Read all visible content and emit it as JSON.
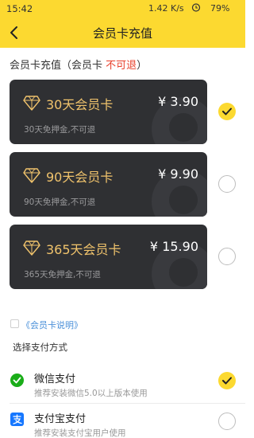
{
  "status_bar": {
    "time": "15:42",
    "speed": "1.42 K/s",
    "battery": "79%"
  },
  "header": {
    "title": "会员卡充值"
  },
  "section": {
    "title_prefix": "会员卡充值（会员卡 ",
    "title_red": "不可退",
    "title_suffix": "）"
  },
  "cards": [
    {
      "name": "30天会员卡",
      "price": "¥ 3.90",
      "desc": "30天免押金,不可退",
      "selected": true
    },
    {
      "name": "90天会员卡",
      "price": "¥ 9.90",
      "desc": "90天免押金,不可退",
      "selected": false
    },
    {
      "name": "365天会员卡",
      "price": "¥ 15.90",
      "desc": "365天免押金,不可退",
      "selected": false
    }
  ],
  "explain_link": "《会员卡说明》",
  "payment": {
    "title": "选择支付方式",
    "methods": [
      {
        "name": "微信支付",
        "desc": "推荐安装微信5.0以上版本使用",
        "selected": true
      },
      {
        "name": "支付宝支付",
        "desc": "推荐安装支付宝用户使用",
        "selected": false
      }
    ]
  },
  "colors": {
    "accent": "#fcd930",
    "card_bg": "#2f3033",
    "card_gold": "#f0c36c",
    "warning_red": "#e8412c",
    "link_blue": "#4a90d9",
    "wechat_green": "#1aad19",
    "alipay_blue": "#1677ff"
  },
  "icons": {
    "back": "chevron-left-icon",
    "card": "diamond-icon",
    "check": "check-icon",
    "wechat": "wechat-icon",
    "alipay": "alipay-icon"
  }
}
